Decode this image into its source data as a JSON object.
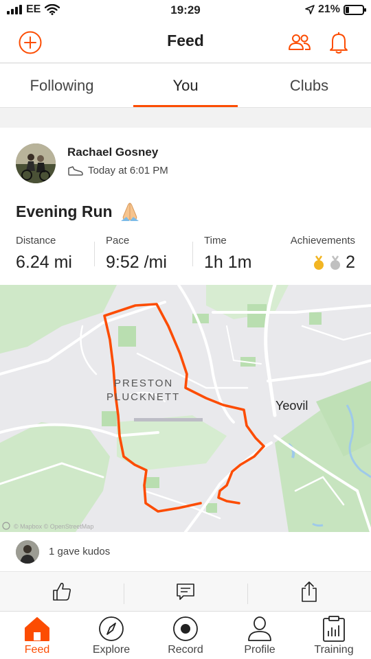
{
  "status_bar": {
    "carrier": "EE",
    "time": "19:29",
    "battery": "21%",
    "battery_level": 0.21
  },
  "header": {
    "title": "Feed"
  },
  "tabs": [
    {
      "label": "Following",
      "active": false
    },
    {
      "label": "You",
      "active": true
    },
    {
      "label": "Clubs",
      "active": false
    }
  ],
  "activity": {
    "athlete": "Rachael Gosney",
    "timestamp": "Today at 6:01 PM",
    "title": "Evening Run",
    "stats": {
      "distance_label": "Distance",
      "distance": "6.24 mi",
      "pace_label": "Pace",
      "pace": "9:52 /mi",
      "time_label": "Time",
      "time": "1h 1m",
      "achievements_label": "Achievements",
      "achievements": "2"
    },
    "map": {
      "place_1": "PRESTON",
      "place_2": "PLUCKNETT",
      "town": "Yeovil",
      "attribution": "© Mapbox © OpenStreetMap"
    },
    "kudos": "1 gave kudos"
  },
  "bottom_nav": [
    {
      "label": "Feed",
      "icon": "home-icon",
      "active": true
    },
    {
      "label": "Explore",
      "icon": "compass-icon",
      "active": false
    },
    {
      "label": "Record",
      "icon": "record-icon",
      "active": false
    },
    {
      "label": "Profile",
      "icon": "person-icon",
      "active": false
    },
    {
      "label": "Training",
      "icon": "clipboard-chart-icon",
      "active": false
    }
  ],
  "colors": {
    "accent": "#fc4c02",
    "gold": "#f2b523",
    "silver": "#c0c0c0"
  }
}
